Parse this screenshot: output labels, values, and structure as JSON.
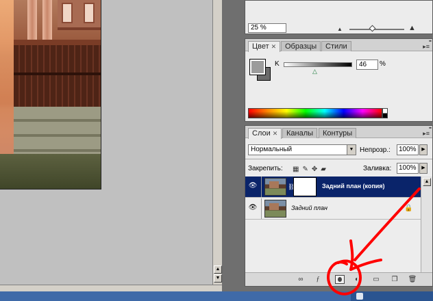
{
  "navigator": {
    "zoom_value": "25 %"
  },
  "color_panel": {
    "tabs": [
      {
        "label": "Цвет"
      },
      {
        "label": "Образцы"
      },
      {
        "label": "Стили"
      }
    ],
    "channel_label": "K",
    "channel_value": "46",
    "percent_sign": "%",
    "colors": {
      "foreground": "#9b9b9b",
      "background": "#6a6a6a"
    }
  },
  "layers_panel": {
    "tabs": [
      {
        "label": "Слои"
      },
      {
        "label": "Каналы"
      },
      {
        "label": "Контуры"
      }
    ],
    "blend_mode": "Нормальный",
    "opacity_label": "Непрозр.:",
    "opacity_value": "100%",
    "lock_label": "Закрепить:",
    "fill_label": "Заливка:",
    "fill_value": "100%",
    "layers": [
      {
        "name": "Задний план (копия)",
        "selected": true,
        "has_mask": true
      },
      {
        "name": "Задний план",
        "selected": false,
        "has_mask": false,
        "locked": true
      }
    ],
    "selection_color": "#0a246a"
  },
  "annotation": {
    "color": "#ff0000"
  },
  "icons": [
    "eye-icon",
    "link-icon",
    "fx-icon",
    "layer-mask-icon",
    "adjustment-icon",
    "folder-icon",
    "new-layer-icon",
    "trash-icon",
    "lock-icon",
    "brush-icon",
    "move-icon",
    "transparency-lock-icon"
  ]
}
